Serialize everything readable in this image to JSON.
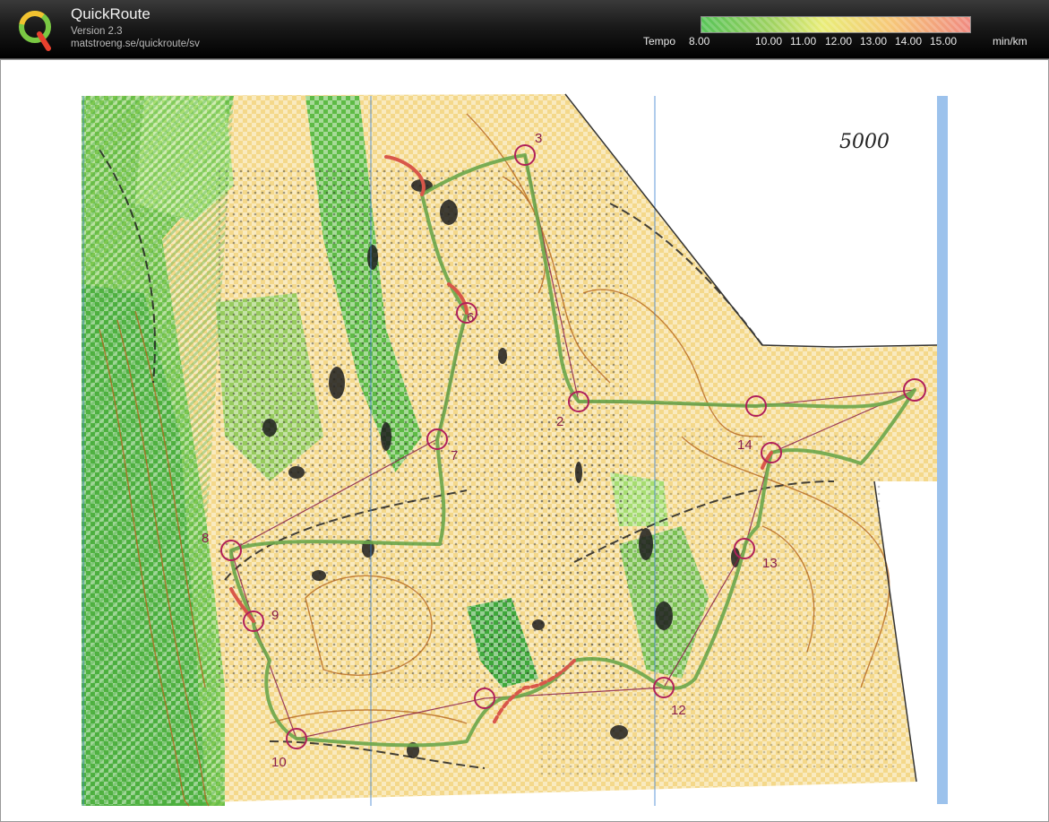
{
  "app": {
    "title": "QuickRoute",
    "version": "Version 2.3",
    "url": "matstroeng.se/quickroute/sv"
  },
  "legend": {
    "label": "Tempo",
    "unit": "min/km",
    "ticks": [
      "8.00",
      "10.00",
      "11.00",
      "12.00",
      "13.00",
      "14.00",
      "15.00"
    ],
    "colors": [
      "#58c458",
      "#9fd260",
      "#e9ed78",
      "#f6c878",
      "#f08a80"
    ]
  },
  "map": {
    "handwritten_note": "5000",
    "control_labels": [
      "3",
      "6",
      "2",
      "7",
      "14",
      "8",
      "9",
      "13",
      "12",
      "10"
    ],
    "colors": {
      "open_land": "#f4d88a",
      "forest_green": "#7ec850",
      "dense_green": "#3fa83a",
      "rock": "#1e1e1e",
      "contour": "#b5651d",
      "control_circle": "#b0205a",
      "route_fast": "#6aa64a",
      "route_slow": "#d8574a"
    }
  }
}
